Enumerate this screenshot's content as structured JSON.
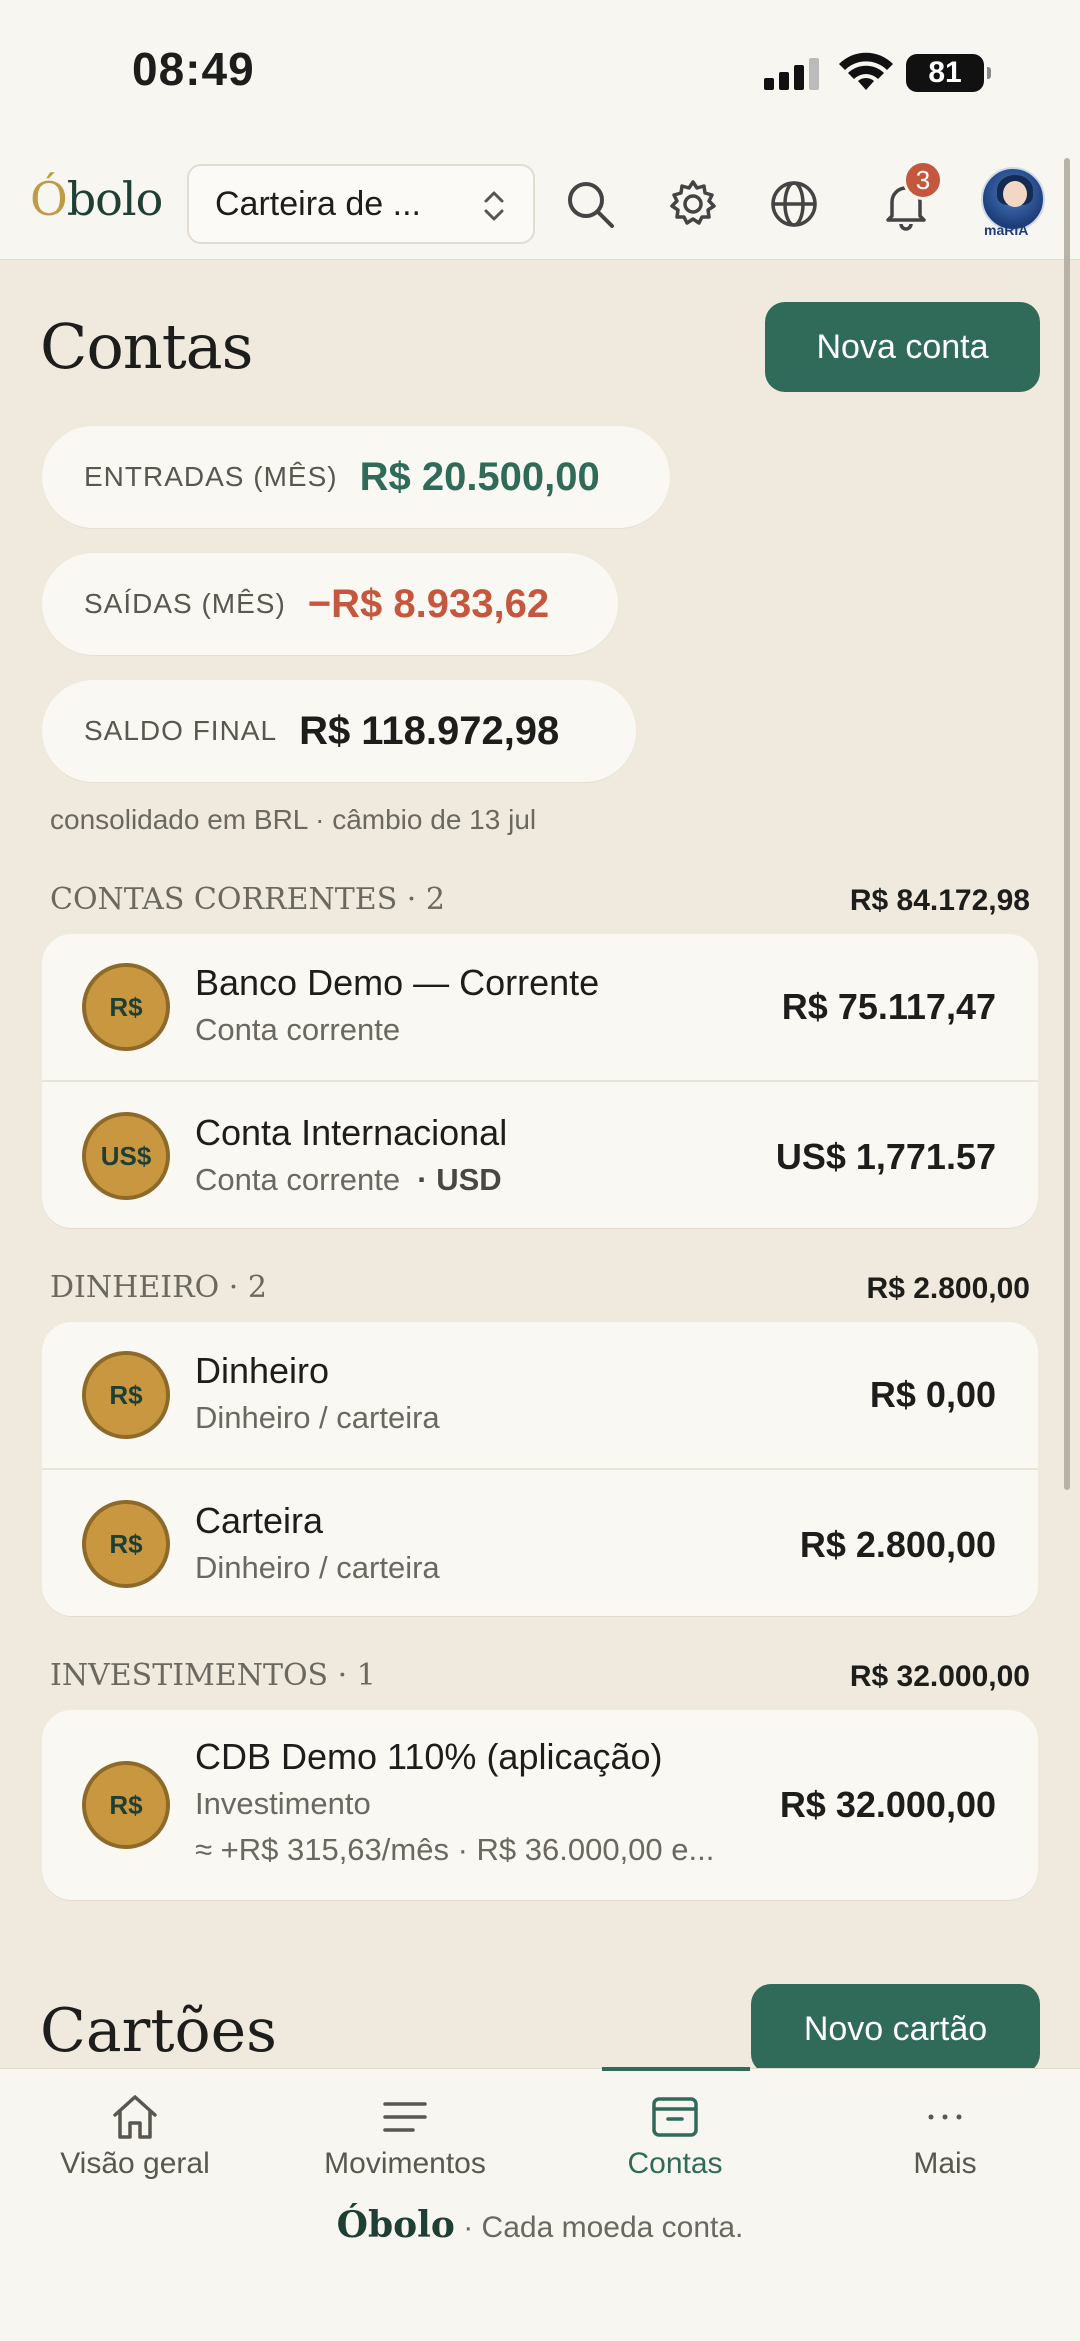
{
  "status_bar": {
    "time": "08:49",
    "battery": "81"
  },
  "header": {
    "logo_accent": "Ó",
    "logo_rest": "bolo",
    "wallet_select": "Carteira de ...",
    "notifications_count": "3",
    "avatar_label": "maRIA"
  },
  "page": {
    "title": "Contas",
    "new_account_button": "Nova conta"
  },
  "summary": [
    {
      "label": "ENTRADAS (MÊS)",
      "value": "R$ 20.500,00",
      "color": "#2f6b58"
    },
    {
      "label": "SAÍDAS (MÊS)",
      "value": "−R$ 8.933,62",
      "color": "#c4573d"
    },
    {
      "label": "SALDO FINAL",
      "value": "R$ 118.972,98",
      "color": "#1d1d1b"
    }
  ],
  "consolidation_note": "consolidado em BRL · câmbio de 13 jul",
  "sections": [
    {
      "title": "CONTAS CORRENTES · 2",
      "total": "R$ 84.172,98",
      "accounts": [
        {
          "coin": "R$",
          "name": "Banco Demo — Corrente",
          "sub": "Conta corrente",
          "amount": "R$ 75.117,47"
        },
        {
          "coin": "US$",
          "name": "Conta Internacional",
          "sub": "Conta corrente",
          "sub_extra": "· USD",
          "amount": "US$ 1,771.57"
        }
      ]
    },
    {
      "title": "DINHEIRO · 2",
      "total": "R$ 2.800,00",
      "accounts": [
        {
          "coin": "R$",
          "name": "Dinheiro",
          "sub": "Dinheiro / carteira",
          "amount": "R$ 0,00"
        },
        {
          "coin": "R$",
          "name": "Carteira",
          "sub": "Dinheiro / carteira",
          "amount": "R$ 2.800,00"
        }
      ]
    },
    {
      "title": "INVESTIMENTOS · 1",
      "total": "R$ 32.000,00",
      "accounts": [
        {
          "coin": "R$",
          "name": "CDB Demo 110% (aplicação)",
          "sub": "Investimento",
          "sub2": "≈ +R$ 315,63/mês · R$ 36.000,00 e...",
          "amount": "R$ 32.000,00"
        }
      ]
    }
  ],
  "cards_section": {
    "title": "Cartões",
    "new_card_button": "Novo cartão"
  },
  "bottom_nav": {
    "tabs": [
      {
        "label": "Visão geral",
        "icon": "home-icon"
      },
      {
        "label": "Movimentos",
        "icon": "list-icon"
      },
      {
        "label": "Contas",
        "icon": "wallet-icon"
      },
      {
        "label": "Mais",
        "icon": "more-icon"
      }
    ],
    "active_tab": "Contas",
    "tagline_brand": "Óbolo",
    "tagline_text": "· Cada moeda conta."
  }
}
